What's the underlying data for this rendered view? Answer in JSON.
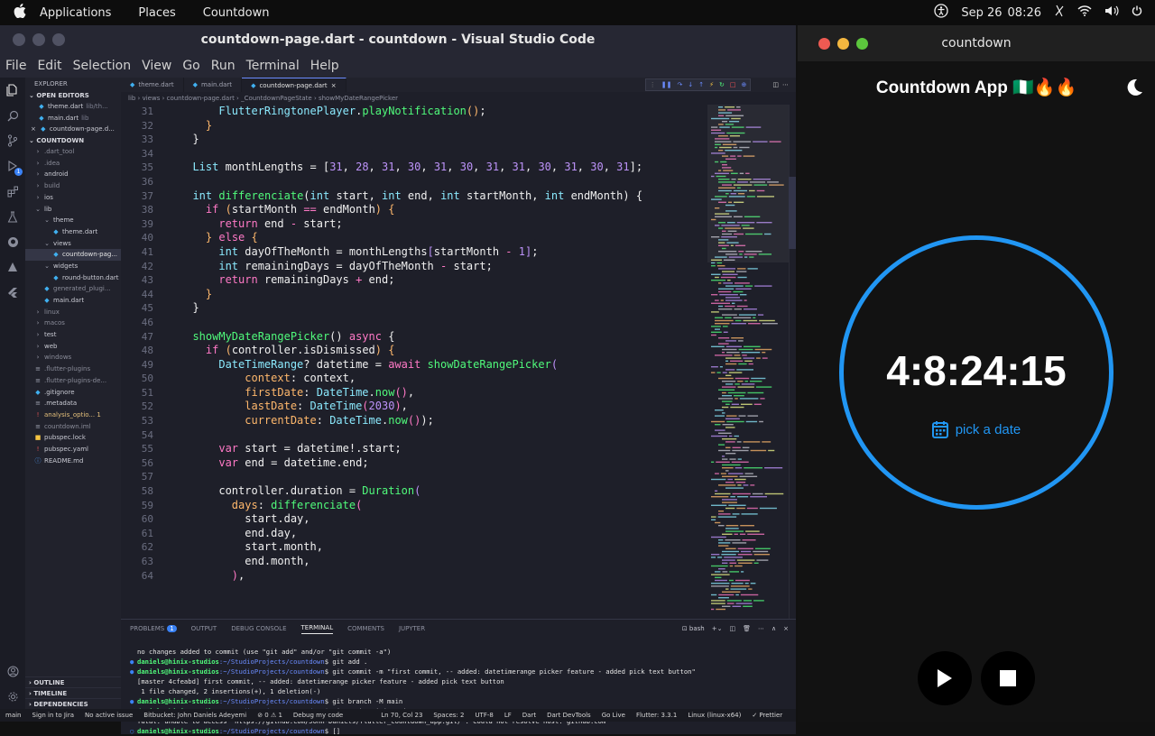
{
  "topbar": {
    "apps": "Applications",
    "places": "Places",
    "active_app": "Countdown",
    "date": "Sep 26",
    "time": "08:26"
  },
  "vscode": {
    "title": "countdown-page.dart - countdown - Visual Studio Code",
    "menu": [
      "File",
      "Edit",
      "Selection",
      "View",
      "Go",
      "Run",
      "Terminal",
      "Help"
    ],
    "explorer_title": "EXPLORER",
    "open_editors_label": "OPEN EDITORS",
    "open_editors": [
      {
        "name": "theme.dart",
        "hint": "lib/th..."
      },
      {
        "name": "main.dart",
        "hint": "lib"
      },
      {
        "name": "countdown-page.d...",
        "hint": ""
      }
    ],
    "project_label": "COUNTDOWN",
    "tree": [
      {
        "name": ".dart_tool",
        "indent": 1,
        "icon": "›",
        "color": "#8a8c99"
      },
      {
        "name": ".idea",
        "indent": 1,
        "icon": "›",
        "color": "#8a8c99"
      },
      {
        "name": "android",
        "indent": 1,
        "icon": "›",
        "color": "#c9cad3"
      },
      {
        "name": "build",
        "indent": 1,
        "icon": "›",
        "color": "#8a8c99"
      },
      {
        "name": "ios",
        "indent": 1,
        "icon": "›",
        "color": "#c9cad3"
      },
      {
        "name": "lib",
        "indent": 1,
        "icon": "⌄",
        "color": "#c9cad3"
      },
      {
        "name": "theme",
        "indent": 2,
        "icon": "⌄",
        "color": "#c9cad3"
      },
      {
        "name": "theme.dart",
        "indent": 3,
        "icon": "◆",
        "color": "#c9cad3"
      },
      {
        "name": "views",
        "indent": 2,
        "icon": "⌄",
        "color": "#c9cad3"
      },
      {
        "name": "countdown-pag...",
        "indent": 3,
        "icon": "◆",
        "color": "#e6e6e6"
      },
      {
        "name": "widgets",
        "indent": 2,
        "icon": "⌄",
        "color": "#c9cad3"
      },
      {
        "name": "round-button.dart",
        "indent": 3,
        "icon": "◆",
        "color": "#c9cad3"
      },
      {
        "name": "generated_plugi...",
        "indent": 2,
        "icon": "◆",
        "color": "#8a8c99"
      },
      {
        "name": "main.dart",
        "indent": 2,
        "icon": "◆",
        "color": "#c9cad3"
      },
      {
        "name": "linux",
        "indent": 1,
        "icon": "›",
        "color": "#8a8c99"
      },
      {
        "name": "macos",
        "indent": 1,
        "icon": "›",
        "color": "#8a8c99"
      },
      {
        "name": "test",
        "indent": 1,
        "icon": "›",
        "color": "#c9cad3"
      },
      {
        "name": "web",
        "indent": 1,
        "icon": "›",
        "color": "#c9cad3"
      },
      {
        "name": "windows",
        "indent": 1,
        "icon": "›",
        "color": "#8a8c99"
      },
      {
        "name": ".flutter-plugins",
        "indent": 1,
        "icon": "≡",
        "color": "#8a8c99"
      },
      {
        "name": ".flutter-plugins-de...",
        "indent": 1,
        "icon": "≡",
        "color": "#8a8c99"
      },
      {
        "name": ".gitignore",
        "indent": 1,
        "icon": "◆",
        "color": "#c9cad3"
      },
      {
        "name": ".metadata",
        "indent": 1,
        "icon": "≡",
        "color": "#c9cad3"
      },
      {
        "name": "analysis_optio... 1",
        "indent": 1,
        "icon": "!",
        "color": "#e5c07b"
      },
      {
        "name": "countdown.iml",
        "indent": 1,
        "icon": "≡",
        "color": "#8a8c99"
      },
      {
        "name": "pubspec.lock",
        "indent": 1,
        "icon": "■",
        "color": "#c9cad3"
      },
      {
        "name": "pubspec.yaml",
        "indent": 1,
        "icon": "!",
        "color": "#c9cad3"
      },
      {
        "name": "README.md",
        "indent": 1,
        "icon": "ⓘ",
        "color": "#c9cad3"
      }
    ],
    "outline_label": "OUTLINE",
    "timeline_label": "TIMELINE",
    "dependencies_label": "DEPENDENCIES",
    "tabs": [
      "theme.dart",
      "main.dart",
      "countdown-page.dart"
    ],
    "breadcrumb": "lib › views › countdown-page.dart › _CountdownPageState › showMyDateRangePicker",
    "code_lines": [
      {
        "n": "31",
        "html": "      <span class='ty'>FlutterRingtonePlayer</span>.<span class='fn'>playNotification</span><span class='pn'>()</span>;"
      },
      {
        "n": "32",
        "html": "    <span class='pn'>}</span>"
      },
      {
        "n": "33",
        "html": "  }"
      },
      {
        "n": "34",
        "html": ""
      },
      {
        "n": "35",
        "html": "  <span class='ty'>List</span> monthLengths = [<span class='num'>31</span>, <span class='num'>28</span>, <span class='num'>31</span>, <span class='num'>30</span>, <span class='num'>31</span>, <span class='num'>30</span>, <span class='num'>31</span>, <span class='num'>31</span>, <span class='num'>30</span>, <span class='num'>31</span>, <span class='num'>30</span>, <span class='num'>31</span>];"
      },
      {
        "n": "36",
        "html": ""
      },
      {
        "n": "37",
        "html": "  <span class='ty'>int</span> <span class='fn'>differenciate</span>(<span class='ty'>int</span> start, <span class='ty'>int</span> end, <span class='ty'>int</span> startMonth, <span class='ty'>int</span> endMonth) {"
      },
      {
        "n": "38",
        "html": "    <span class='kw'>if</span> <span class='pn'>(</span>startMonth <span class='kw'>==</span> endMonth<span class='pn'>)</span> <span class='pn'>{</span>"
      },
      {
        "n": "39",
        "html": "      <span class='kw'>return</span> end <span class='kw'>-</span> start;"
      },
      {
        "n": "40",
        "html": "    <span class='pn'>}</span> <span class='kw'>else</span> <span class='pn'>{</span>"
      },
      {
        "n": "41",
        "html": "      <span class='ty'>int</span> dayOfTheMonth = monthLengths<span class='num'>[</span>startMonth <span class='kw'>-</span> <span class='num'>1</span><span class='num'>]</span>;"
      },
      {
        "n": "42",
        "html": "      <span class='ty'>int</span> remainingDays = dayOfTheMonth <span class='kw'>-</span> start;"
      },
      {
        "n": "43",
        "html": "      <span class='kw'>return</span> remainingDays <span class='kw'>+</span> end;"
      },
      {
        "n": "44",
        "html": "    <span class='pn'>}</span>"
      },
      {
        "n": "45",
        "html": "  }"
      },
      {
        "n": "46",
        "html": ""
      },
      {
        "n": "47",
        "html": "  <span class='fn'>showMyDateRangePicker</span>() <span class='kw'>async</span> {"
      },
      {
        "n": "48",
        "html": "    <span class='kw'>if</span> <span class='pn'>(</span>controller.isDismissed<span class='pn'>)</span> <span class='pn'>{</span>"
      },
      {
        "n": "49",
        "html": "      <span class='ty'>DateTimeRange</span>? datetime = <span class='kw'>await</span> <span class='fn'>showDateRangePicker</span><span class='num'>(</span>"
      },
      {
        "n": "50",
        "html": "          <span class='prop'>context</span>: context,"
      },
      {
        "n": "51",
        "html": "          <span class='prop'>firstDate</span>: <span class='ty'>DateTime</span>.<span class='fn'>now</span><span class='kw'>()</span>,"
      },
      {
        "n": "52",
        "html": "          <span class='prop'>lastDate</span>: <span class='ty'>DateTime</span><span class='kw'>(</span><span class='num'>2030</span><span class='kw'>)</span>,"
      },
      {
        "n": "53",
        "html": "          <span class='prop'>currentDate</span>: <span class='ty'>DateTime</span>.<span class='fn'>now</span><span class='kw'>()</span>);"
      },
      {
        "n": "54",
        "html": ""
      },
      {
        "n": "55",
        "html": "      <span class='kw'>var</span> start = datetime!.start;"
      },
      {
        "n": "56",
        "html": "      <span class='kw'>var</span> end = datetime.end;"
      },
      {
        "n": "57",
        "html": ""
      },
      {
        "n": "58",
        "html": "      controller.duration = <span class='fn'>Duration</span><span class='num'>(</span>"
      },
      {
        "n": "59",
        "html": "        <span class='prop'>days</span>: <span class='fn'>differenciate</span><span class='kw'>(</span>"
      },
      {
        "n": "60",
        "html": "          start.day,"
      },
      {
        "n": "61",
        "html": "          end.day,"
      },
      {
        "n": "62",
        "html": "          start.month,"
      },
      {
        "n": "63",
        "html": "          end.month,"
      },
      {
        "n": "64",
        "html": "        <span class='kw'>)</span>,"
      }
    ],
    "panel_tabs": [
      "PROBLEMS",
      "OUTPUT",
      "DEBUG CONSOLE",
      "TERMINAL",
      "COMMENTS",
      "JUPYTER"
    ],
    "problems_count": "1",
    "shell": "bash",
    "terminal_lines": [
      {
        "mk": "",
        "user": "",
        "path": "",
        "text": "no changes added to commit (use \"git add\" and/or \"git commit -a\")"
      },
      {
        "mk": "●",
        "user": "daniels@hinix-studios",
        "path": ":~/StudioProjects/countdown",
        "text": "$ git add ."
      },
      {
        "mk": "●",
        "user": "daniels@hinix-studios",
        "path": ":~/StudioProjects/countdown",
        "text": "$ git commit -m \"first commit, -- added: datetimerange picker feature - added pick text button\""
      },
      {
        "mk": "",
        "user": "",
        "path": "",
        "text": "[master 4cfeabd] first commit, -- added: datetimerange picker feature - added pick text button"
      },
      {
        "mk": "",
        "user": "",
        "path": "",
        "text": " 1 file changed, 2 insertions(+), 1 deletion(-)"
      },
      {
        "mk": "●",
        "user": "daniels@hinix-studios",
        "path": ":~/StudioProjects/countdown",
        "text": "$ git branch -M main"
      },
      {
        "mk": "●err",
        "user": "daniels@hinix-studios",
        "path": ":~/StudioProjects/countdown",
        "text": "$ git push origin main"
      },
      {
        "mk": "",
        "user": "",
        "path": "",
        "text": "fatal: unable to access 'https://github.com/John-Daniels/flutter_countdown_app.git/': Could not resolve host: github.com"
      },
      {
        "mk": "○",
        "user": "daniels@hinix-studios",
        "path": ":~/StudioProjects/countdown",
        "text": "$ []"
      }
    ],
    "status": [
      "main",
      "Sign in to Jira",
      "No active issue",
      "Bitbucket: John Daniels Adeyemi",
      "⊘ 0  ⚠ 1",
      "Debug my code",
      "Ln 70, Col 23",
      "Spaces: 2",
      "UTF-8",
      "LF",
      "Dart",
      "Dart DevTools",
      "Go Live",
      "Flutter: 3.3.1",
      "Linux (linux-x64)",
      "✓ Prettier"
    ]
  },
  "app": {
    "window_title": "countdown",
    "header": "Countdown App 🇳🇬🔥🔥",
    "timer": "4:8:24:15",
    "pick_label": "pick a date",
    "accent": "#2196f3"
  }
}
